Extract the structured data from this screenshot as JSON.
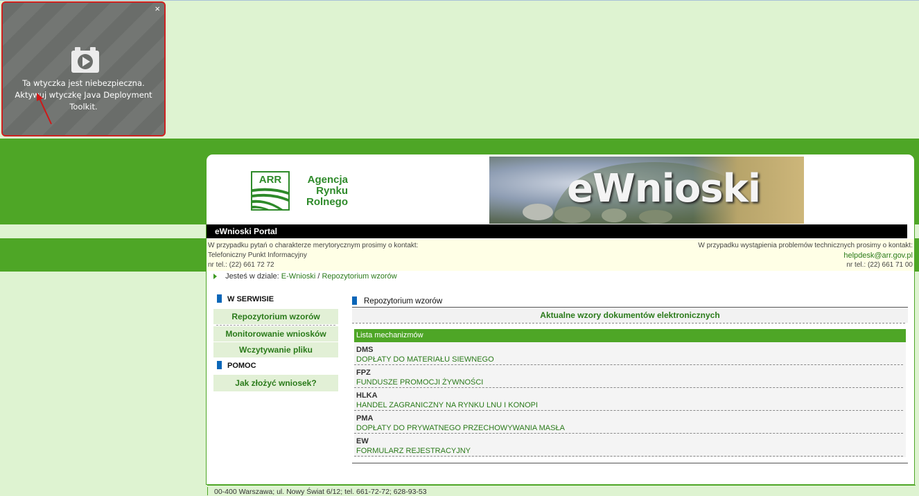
{
  "plugin": {
    "close": "×",
    "message_line1": "Ta wtyczka jest niebezpieczna.",
    "message_line2": "Aktywuj wtyczkę Java Deployment Toolkit."
  },
  "header": {
    "logo_mark": "ARR",
    "logo_lines": [
      "Agencja",
      "Rynku",
      "Rolnego"
    ],
    "banner_title": "eWnioski",
    "portal_title": "eWnioski Portal"
  },
  "contact": {
    "left_line1": "W przypadku pytań o charakterze merytorycznym prosimy o kontakt:",
    "left_line2": "Telefoniczny Punkt Informacyjny",
    "left_line3": "nr tel.: (22) 661 72 72",
    "right_line1": "W przypadku wystąpienia problemów technicznych prosimy o kontakt:",
    "right_email": "helpdesk@arr.gov.pl",
    "right_line3": "nr tel.: (22) 661 71 00"
  },
  "breadcrumb": {
    "prefix": "Jesteś w dziale:",
    "item1": "E-Wnioski",
    "separator": "/",
    "item2": "Repozytorium wzorów"
  },
  "sidebar": {
    "section1": "W SERWISIE",
    "items": [
      "Repozytorium wzorów",
      "Monitorowanie wniosków",
      "Wczytywanie pliku"
    ],
    "section2": "POMOC",
    "help_items": [
      "Jak złożyć wniosek?"
    ]
  },
  "main": {
    "heading": "Repozytorium wzorów",
    "subheading": "Aktualne wzory dokumentów elektronicznych",
    "list_title": "Lista mechanizmów",
    "mechanisms": [
      {
        "code": "DMS",
        "name": "DOPŁATY DO MATERIAŁU SIEWNEGO"
      },
      {
        "code": "FPZ",
        "name": "FUNDUSZE PROMOCJI ŻYWNOŚCI"
      },
      {
        "code": "HLKA",
        "name": "HANDEL ZAGRANICZNY NA RYNKU LNU I KONOPI"
      },
      {
        "code": "PMA",
        "name": "DOPŁATY DO PRYWATNEGO PRZECHOWYWANIA MASŁA"
      },
      {
        "code": "EW",
        "name": "FORMULARZ REJESTRACYJNY"
      }
    ]
  },
  "footer": {
    "text": "00-400 Warszawa; ul. Nowy Świat 6/12; tel. 661-72-72; 628-93-53"
  },
  "colors": {
    "brand_green": "#4ea626",
    "page_bg": "#def3d1",
    "link_green": "#2a7a1a",
    "marker_blue": "#0a66b8"
  }
}
